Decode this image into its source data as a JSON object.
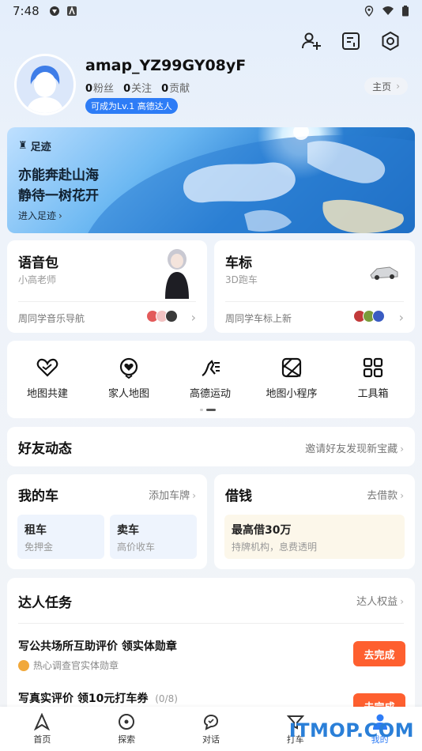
{
  "status_bar": {
    "time": "7:48"
  },
  "top_actions": {
    "add_friend_icon": "person-add-icon",
    "note_icon": "note-icon",
    "settings_icon": "gear-icon"
  },
  "profile": {
    "username": "amap_YZ99GY08yF",
    "fans_count": "0",
    "fans_label": "粉丝",
    "follow_count": "0",
    "follow_label": "关注",
    "contrib_count": "0",
    "contrib_label": "贡献",
    "level_badge": "可成为Lv.1 高德达人",
    "home_link": "主页"
  },
  "banner": {
    "tag": "足迹",
    "line1": "亦能奔赴山海",
    "line2": "静待一树花开",
    "enter": "进入足迹"
  },
  "voice_card": {
    "title": "语音包",
    "subtitle": "小高老师",
    "footer": "周同学音乐导航"
  },
  "car_icon_card": {
    "title": "车标",
    "subtitle": "3D跑车",
    "footer": "周同学车标上新"
  },
  "tools": [
    {
      "label": "地图共建",
      "icon": "heart-map-icon"
    },
    {
      "label": "家人地图",
      "icon": "family-heart-icon"
    },
    {
      "label": "高德运动",
      "icon": "running-icon"
    },
    {
      "label": "地图小程序",
      "icon": "mini-program-icon"
    },
    {
      "label": "工具箱",
      "icon": "grid-icon"
    }
  ],
  "friends": {
    "title": "好友动态",
    "invite": "邀请好友发现新宝藏"
  },
  "my_car": {
    "title": "我的车",
    "action": "添加车牌",
    "rent_title": "租车",
    "rent_sub": "免押金",
    "sell_title": "卖车",
    "sell_sub": "高价收车"
  },
  "loan": {
    "title": "借钱",
    "action": "去借款",
    "box_title": "最高借30万",
    "box_sub": "持牌机构，息费透明"
  },
  "tasks": {
    "title": "达人任务",
    "action": "达人权益",
    "items": [
      {
        "title": "写公共场所互助评价 领实体勋章",
        "subtitle": "热心调查官实体勋章",
        "button": "去完成"
      },
      {
        "title": "写真实评价 领10元打车券",
        "progress": "(0/8)",
        "button": "去完成"
      }
    ]
  },
  "tabbar": [
    {
      "label": "首页",
      "icon": "navigate-arrow-icon"
    },
    {
      "label": "探索",
      "icon": "explore-icon"
    },
    {
      "label": "对话",
      "icon": "chat-icon"
    },
    {
      "label": "打车",
      "icon": "taxi-icon"
    },
    {
      "label": "我的",
      "icon": "profile-icon"
    }
  ],
  "watermark": "ITMOP.COM",
  "colors": {
    "accent": "#2d7cf6",
    "cta": "#fe5f2f"
  }
}
